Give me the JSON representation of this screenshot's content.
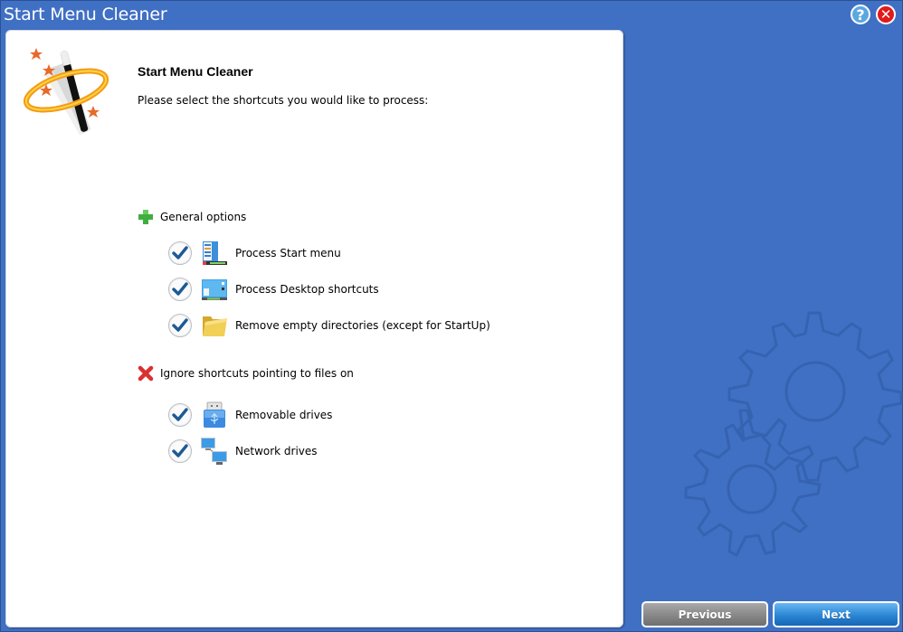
{
  "window": {
    "title": "Start Menu Cleaner",
    "help_label": "?",
    "close_label": "✕"
  },
  "content": {
    "heading": "Start Menu Cleaner",
    "subheading": "Please select the shortcuts you would like to process:",
    "sections": [
      {
        "label": "General options",
        "icon": "plus-icon",
        "options": [
          {
            "label": "Process Start menu",
            "checked": true,
            "icon": "start-menu-icon"
          },
          {
            "label": "Process Desktop shortcuts",
            "checked": true,
            "icon": "desktop-icon"
          },
          {
            "label": "Remove empty directories (except for StartUp)",
            "checked": true,
            "icon": "folder-icon"
          }
        ]
      },
      {
        "label": "Ignore shortcuts pointing to files on",
        "icon": "cross-icon",
        "options": [
          {
            "label": "Removable drives",
            "checked": true,
            "icon": "usb-drive-icon"
          },
          {
            "label": "Network drives",
            "checked": true,
            "icon": "network-drive-icon"
          }
        ]
      }
    ]
  },
  "footer": {
    "previous_label": "Previous",
    "next_label": "Next"
  },
  "colors": {
    "background": "#4070c4",
    "check": "#1c5a96",
    "next_button": "#2f8ad6",
    "previous_button": "#8a8a8a"
  }
}
